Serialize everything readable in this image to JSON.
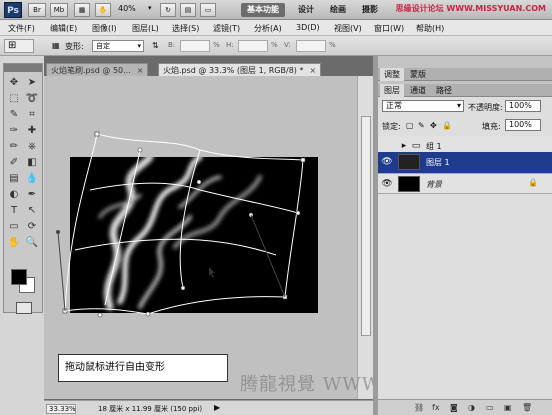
{
  "app": {
    "logo": "Ps",
    "br_label": "Br",
    "mb_label": "Mb",
    "zoom": "40%",
    "workspaces": [
      "基本功能",
      "设计",
      "绘画",
      "摄影"
    ],
    "brand_watermark": "思缘设计论坛 WWW.MISSYUAN.COM"
  },
  "menu": [
    "文件(F)",
    "编辑(E)",
    "图像(I)",
    "图层(L)",
    "选择(S)",
    "滤镜(T)",
    "分析(A)",
    "3D(D)",
    "视图(V)",
    "窗口(W)",
    "帮助(H)"
  ],
  "options": {
    "transform_label": "变形:",
    "transform_value": "自定",
    "percent": "%",
    "h_label": "H:",
    "v_label": "V:"
  },
  "tabs": [
    {
      "label": "火焰笔刷.psd @ 50...",
      "close": "×"
    },
    {
      "label": "火焰.psd @ 33.3% (图层 1, RGB/8) *",
      "close": "×"
    }
  ],
  "caption": "拖动鼠标进行自由变形",
  "bottom_watermark": "腾龍視覺 WWW.TLVI.NET",
  "status": {
    "zoom": "33.33%",
    "doc_info": "18 厘米 x 11.99 厘米 (150 ppi)",
    "arrow": "▶"
  },
  "right_panel": {
    "top_tabs": [
      "调整",
      "蒙版"
    ],
    "layer_tabs": [
      "图层",
      "通道",
      "路径"
    ],
    "blend_mode": "正常",
    "opacity_label": "不透明度:",
    "opacity_value": "100%",
    "lock_label": "锁定:",
    "fill_label": "填充:",
    "fill_value": "100%",
    "layers": [
      {
        "name": "组 1",
        "type": "group",
        "selected": false
      },
      {
        "name": "图层 1",
        "type": "layer",
        "selected": true
      },
      {
        "name": "背景",
        "type": "background",
        "selected": false
      }
    ],
    "footer_icons": [
      "link-icon",
      "fx-icon",
      "mask-icon",
      "adjustment-icon",
      "folder-icon",
      "new-layer-icon",
      "trash-icon"
    ]
  }
}
